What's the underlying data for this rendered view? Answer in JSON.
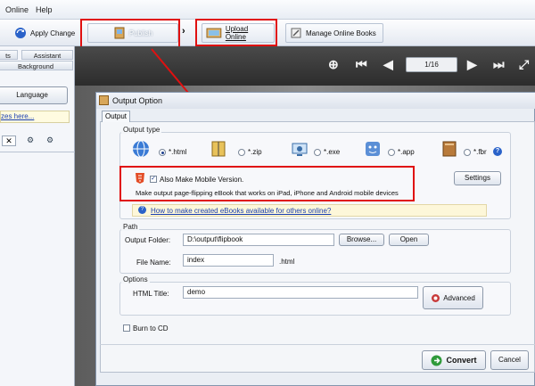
{
  "menu": [
    "Online",
    "Help"
  ],
  "toolbar": {
    "apply_change": "Apply Change",
    "publish": "Publish",
    "upload_online": "Upload Online",
    "manage_online_books": "Manage Online Books"
  },
  "left_panel": {
    "tab_partial": "ts",
    "tab_assistant": "Assistant",
    "tab_background": "Background",
    "language_button": "Language",
    "link_partial": "zes here..."
  },
  "viewer": {
    "page_indicator": "1/16"
  },
  "dialog": {
    "title": "Output Option",
    "tab": "Output",
    "output_type": {
      "label": "Output type",
      "options": [
        {
          "label": "*.html",
          "selected": true
        },
        {
          "label": "*.zip",
          "selected": false
        },
        {
          "label": "*.exe",
          "selected": false
        },
        {
          "label": "*.app",
          "selected": false
        },
        {
          "label": "*.fbr",
          "selected": false
        }
      ],
      "help_icon": "?",
      "mobile_checkbox_label": "Also Make Mobile Version.",
      "mobile_checked": true,
      "mobile_description": "Make output page-flipping eBook that works on iPad, iPhone and Android mobile devices",
      "settings_button": "Settings",
      "info_link": "How to make created eBooks available for others online?"
    },
    "path": {
      "label": "Path",
      "output_folder_label": "Output Folder:",
      "output_folder_value": "D:\\output\\flipbook",
      "browse_button": "Browse...",
      "open_button": "Open",
      "file_name_label": "File Name:",
      "file_name_value": "index",
      "file_ext": ".html"
    },
    "options": {
      "label": "Options",
      "html_title_label": "HTML Title:",
      "html_title_value": "demo",
      "advanced_button": "Advanced"
    },
    "burn_to_cd_label": "Burn to CD",
    "burn_to_cd_checked": false,
    "convert_button": "Convert",
    "cancel_button": "Cancel"
  },
  "colors": {
    "annotation_red": "#e01010",
    "link_blue": "#1a3fb0"
  }
}
